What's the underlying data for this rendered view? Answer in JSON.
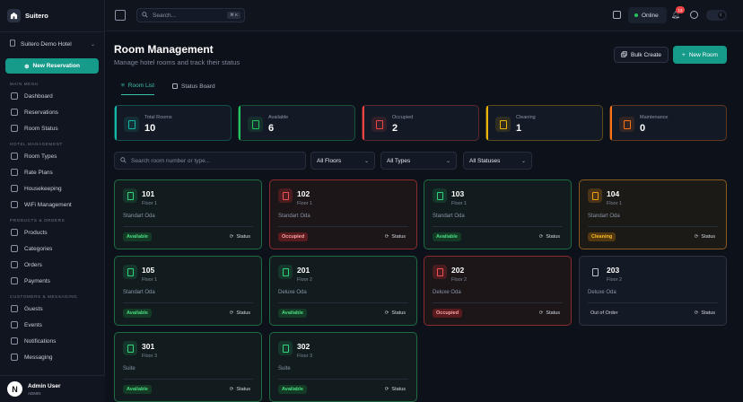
{
  "brand": {
    "name": "Suitero"
  },
  "sidebar": {
    "hotel": "Suitero Demo Hotel",
    "new_reservation": "New Reservation",
    "sections": [
      {
        "title": "MAIN MENU",
        "items": [
          {
            "label": "Dashboard",
            "icon": "dashboard-icon"
          },
          {
            "label": "Reservations",
            "icon": "calendar-icon"
          },
          {
            "label": "Room Status",
            "icon": "room-icon"
          }
        ]
      },
      {
        "title": "HOTEL MANAGEMENT",
        "items": [
          {
            "label": "Room Types",
            "icon": "building-icon"
          },
          {
            "label": "Rate Plans",
            "icon": "tag-icon"
          },
          {
            "label": "Housekeeping",
            "icon": "broom-icon"
          },
          {
            "label": "WiFi Management",
            "icon": "wifi-icon"
          }
        ]
      },
      {
        "title": "PRODUCTS & ORDERS",
        "items": [
          {
            "label": "Products",
            "icon": "box-icon"
          },
          {
            "label": "Categories",
            "icon": "folder-icon"
          },
          {
            "label": "Orders",
            "icon": "cart-icon"
          },
          {
            "label": "Payments",
            "icon": "card-icon"
          }
        ]
      },
      {
        "title": "CUSTOMERS & MESSAGING",
        "items": [
          {
            "label": "Guests",
            "icon": "users-icon"
          },
          {
            "label": "Events",
            "icon": "calendar-icon"
          },
          {
            "label": "Notifications",
            "icon": "bell-icon"
          },
          {
            "label": "Messaging",
            "icon": "message-icon"
          }
        ]
      }
    ],
    "user": {
      "initial": "N",
      "name": "Admin User",
      "role": "ADMIN"
    }
  },
  "topbar": {
    "search_placeholder": "Search...",
    "shortcut": "⌘ K",
    "online": "Online",
    "notification_count": "13"
  },
  "page": {
    "title": "Room Management",
    "subtitle": "Manage hotel rooms and track their status",
    "bulk_create": "Bulk Create",
    "new_room": "New Room",
    "tabs": [
      "Room List",
      "Status Board"
    ]
  },
  "stats": [
    {
      "label": "Total Rooms",
      "value": "10",
      "color": "#14b8a6"
    },
    {
      "label": "Available",
      "value": "6",
      "color": "#22c55e"
    },
    {
      "label": "Occupied",
      "value": "2",
      "color": "#ef4444"
    },
    {
      "label": "Cleaning",
      "value": "1",
      "color": "#eab308"
    },
    {
      "label": "Maintenance",
      "value": "0",
      "color": "#f97316"
    }
  ],
  "filters": {
    "search_placeholder": "Search room number or type...",
    "floors": "All Floors",
    "types": "All Types",
    "statuses": "All Statuses"
  },
  "status_button": "Status",
  "rooms": [
    {
      "number": "101",
      "floor": "Floor 1",
      "type": "Standart Oda",
      "status": "Available",
      "tone": "green"
    },
    {
      "number": "102",
      "floor": "Floor 1",
      "type": "Standart Oda",
      "status": "Occupied",
      "tone": "red"
    },
    {
      "number": "103",
      "floor": "Floor 1",
      "type": "Standart Oda",
      "status": "Available",
      "tone": "green"
    },
    {
      "number": "104",
      "floor": "Floor 1",
      "type": "Standart Oda",
      "status": "Cleaning",
      "tone": "amber"
    },
    {
      "number": "105",
      "floor": "Floor 1",
      "type": "Standart Oda",
      "status": "Available",
      "tone": "green"
    },
    {
      "number": "201",
      "floor": "Floor 2",
      "type": "Deluxe Oda",
      "status": "Available",
      "tone": "green"
    },
    {
      "number": "202",
      "floor": "Floor 2",
      "type": "Deluxe Oda",
      "status": "Occupied",
      "tone": "red"
    },
    {
      "number": "203",
      "floor": "Floor 2",
      "type": "Deluxe Oda",
      "status": "Out of Order",
      "tone": "gray"
    },
    {
      "number": "301",
      "floor": "Floor 3",
      "type": "Suite",
      "status": "Available",
      "tone": "green"
    },
    {
      "number": "302",
      "floor": "Floor 3",
      "type": "Suite",
      "status": "Available",
      "tone": "green"
    }
  ]
}
